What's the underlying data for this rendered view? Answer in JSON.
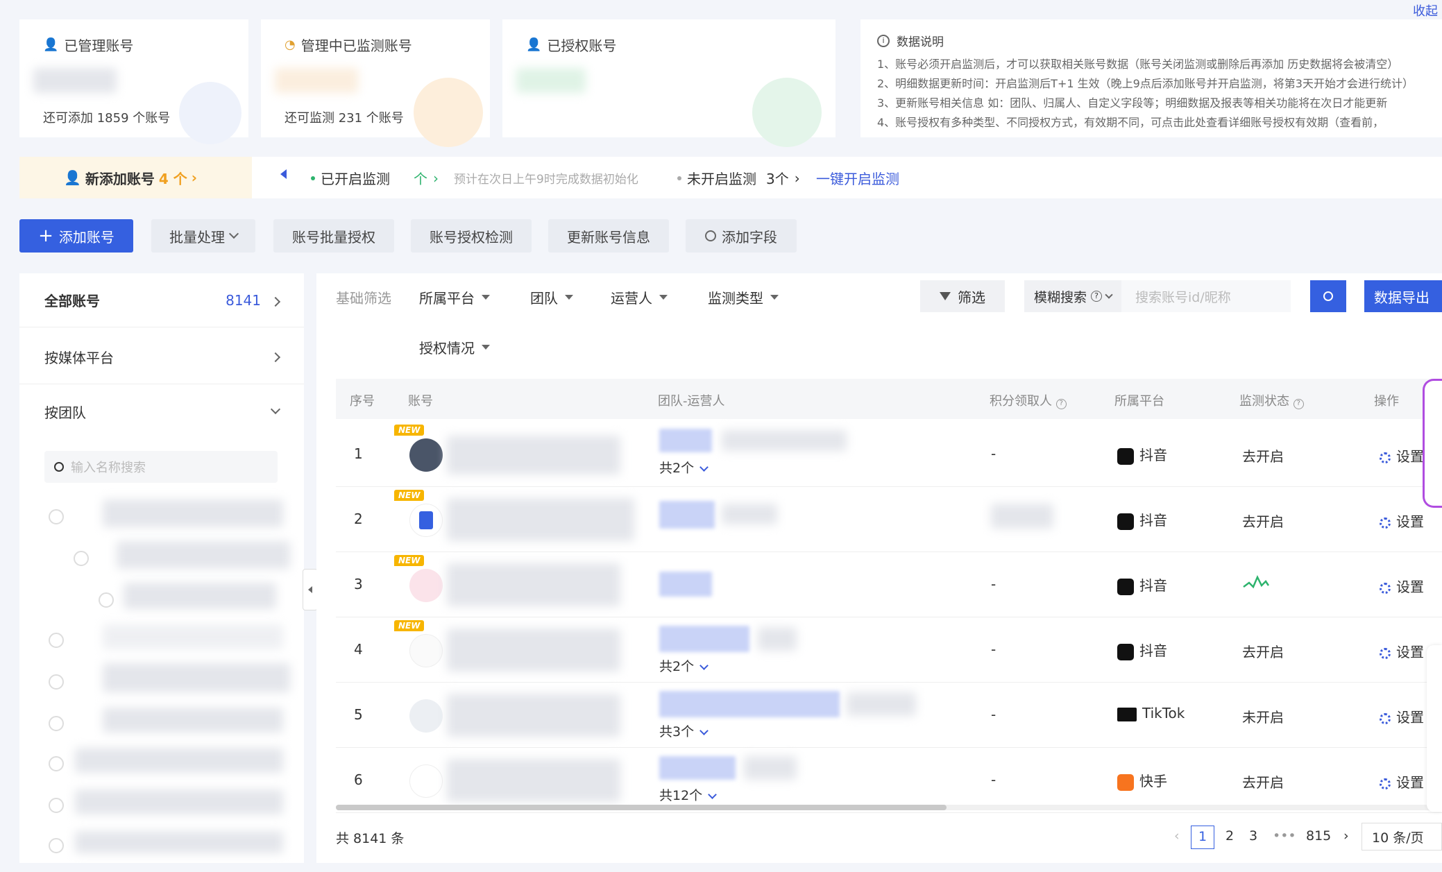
{
  "top_link": "收起",
  "cards": [
    {
      "title": "已管理账号",
      "sub": "还可添加 1859 个账号",
      "icon": "user-icon"
    },
    {
      "title": "管理中已监测账号",
      "sub": "还可监测 231 个账号",
      "icon": "monitor-icon"
    },
    {
      "title": "已授权账号",
      "sub": "",
      "icon": "user-check-icon"
    }
  ],
  "notes": {
    "title": "数据说明",
    "lines": [
      "1、账号必须开启监测后，才可以获取相关账号数据（账号关闭监测或删除后再添加 历史数据将会被清空）",
      "2、明细数据更新时间：开启监测后T+1 生效（晚上9点后添加账号并开启监测，将第3天开始才会进行统计）",
      "3、更新账号相关信息 如：团队、归属人、自定义字段等；明细数据及报表等相关功能将在次日才能更新",
      "4、账号授权有多种类型、不同授权方式，有效期不同，可点击此处查看详细账号授权有效期（查看前，"
    ]
  },
  "new_bar": {
    "tag": "新添加账号",
    "tag_count": "4 个",
    "monitoring_on": "已开启监测",
    "monitoring_on_count": "个",
    "monitoring_note": "预计在次日上午9时完成数据初始化",
    "monitoring_off": "未开启监测",
    "monitoring_off_count": "3个",
    "one_click": "一键开启监测"
  },
  "toolbar": {
    "add": "添加账号",
    "batch": "批量处理",
    "batch_auth": "账号批量授权",
    "auth_check": "账号授权检测",
    "update_info": "更新账号信息",
    "add_field": "添加字段"
  },
  "sidebar": {
    "all_label": "全部账号",
    "all_count": "8141",
    "by_platform": "按媒体平台",
    "by_team": "按团队",
    "search_placeholder": "输入名称搜索"
  },
  "filters": {
    "basic": "基础筛选",
    "platform": "所属平台",
    "team": "团队",
    "operator": "运营人",
    "monitor_type": "监测类型",
    "auth": "授权情况",
    "filter_btn": "筛选",
    "fuzzy": "模糊搜索",
    "search_placeholder": "搜索账号id/昵称",
    "export": "数据导出"
  },
  "table": {
    "headers": [
      "序号",
      "账号",
      "团队-运营人",
      "积分领取人",
      "所属平台",
      "监测状态",
      "操作"
    ],
    "rows": [
      {
        "no": "1",
        "new": "NEW",
        "team_count": "共2个",
        "points": "-",
        "platform": "抖音",
        "status": "去开启",
        "action": "设置"
      },
      {
        "no": "2",
        "new": "NEW",
        "team_count": "",
        "points": "",
        "platform": "抖音",
        "status": "去开启",
        "action": "设置"
      },
      {
        "no": "3",
        "new": "NEW",
        "team_count": "",
        "points": "-",
        "platform": "抖音",
        "status": "",
        "action": "设置"
      },
      {
        "no": "4",
        "new": "NEW",
        "team_count": "共2个",
        "points": "-",
        "platform": "抖音",
        "status": "去开启",
        "action": "设置"
      },
      {
        "no": "5",
        "new": "",
        "team_count": "共3个",
        "points": "-",
        "platform": "TikTok",
        "status": "未开启",
        "action": "设置"
      },
      {
        "no": "6",
        "new": "",
        "team_count": "共12个",
        "points": "-",
        "platform": "快手",
        "status": "去开启",
        "action": "设置"
      }
    ]
  },
  "pagination": {
    "total": "共 8141 条",
    "pages": [
      "1",
      "2",
      "3",
      "•••",
      "815"
    ],
    "page_size": "10 条/页"
  },
  "colors": {
    "primary": "#3560e0",
    "link": "#3b5bdb",
    "new_badge": "#f7b500"
  }
}
